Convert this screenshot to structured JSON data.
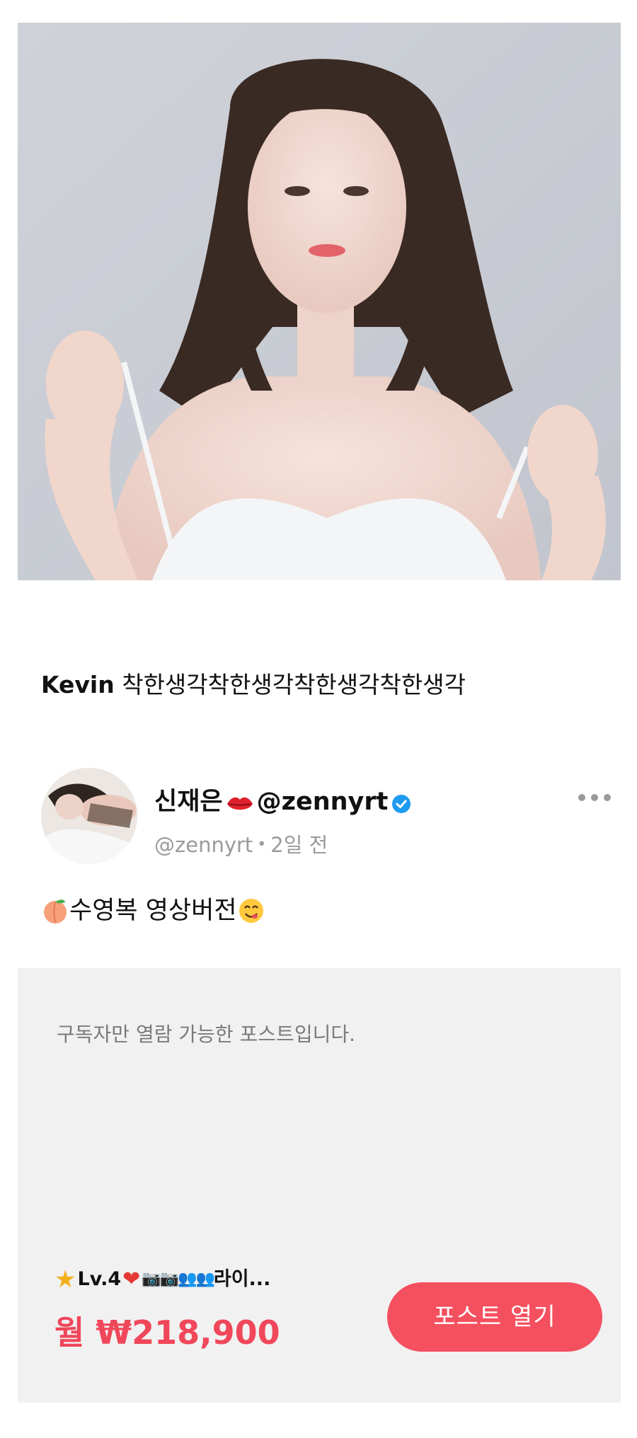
{
  "hero": {
    "image_alt": "woman portrait photo"
  },
  "caption": {
    "author": "Kevin",
    "text": "착한생각착한생각착한생각착한생각"
  },
  "post": {
    "display_name_prefix": "신재은",
    "display_name_suffix": "@zennyrt",
    "handle": "@zennyrt",
    "time": "2일 전",
    "text": "수영복 영상버전"
  },
  "locked": {
    "note": "구독자만 열람 가능한 포스트입니다.",
    "tier_level": "Lv.4",
    "tier_suffix": "라이...",
    "price": "월 ₩218,900",
    "open_button": "포스트 열기"
  },
  "colors": {
    "accent": "#f5505f",
    "price": "#f0475a",
    "panel": "#f1f1f1",
    "verified": "#1d9bf0"
  },
  "icons": [
    "lips-icon",
    "verified-badge-icon",
    "more-options-icon",
    "peach-icon",
    "yum-face-icon",
    "star-icon",
    "heart-icon",
    "camera-icon",
    "people-icon"
  ]
}
